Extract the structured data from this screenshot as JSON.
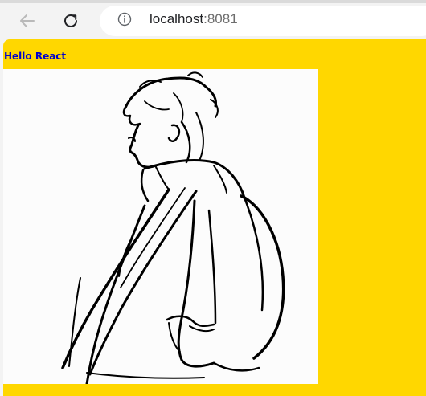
{
  "browser": {
    "address_host": "localhost",
    "address_port": ":8081",
    "back_icon": "arrow-left-icon",
    "reload_icon": "reload-icon",
    "info_icon": "info-icon"
  },
  "page": {
    "heading": "Hello React",
    "background_color": "#ffd700",
    "heading_color": "#0000cd",
    "image": "line-drawing of person in hooded coat, side profile"
  }
}
